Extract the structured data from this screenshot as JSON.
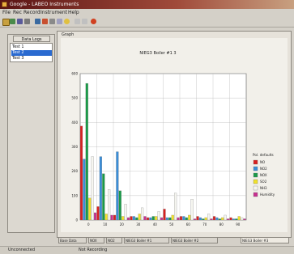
{
  "window": {
    "title": "Google - LABEO Instruments"
  },
  "menu": [
    "File",
    "Rec",
    "Record",
    "Instrument",
    "Help"
  ],
  "left_panel": {
    "button_label": "Data Logs",
    "items": [
      {
        "label": "Test 1",
        "selected": false
      },
      {
        "label": "Test 2",
        "selected": true
      },
      {
        "label": "Test 3",
        "selected": false
      }
    ]
  },
  "graph_panel": {
    "label": "Graph"
  },
  "colors": {
    "red": "#d82020",
    "blue": "#3a8ed8",
    "green": "#1a9a48",
    "yellow": "#f0e22a",
    "white": "#f6f6f0",
    "magenta": "#c83090"
  },
  "chart_data": {
    "type": "bar",
    "title": "NIEG3 Boiler #1 3",
    "categories": [
      "0",
      "10",
      "20",
      "30",
      "40",
      "50",
      "60",
      "70",
      "80",
      "90"
    ],
    "ylim": [
      0,
      600
    ],
    "yticks": [
      "600",
      "500",
      "400",
      "300",
      "200",
      "100",
      "0"
    ],
    "legend_title": "Pol. defaults",
    "series": [
      {
        "name": "NO",
        "color": "#d82020",
        "values": [
          385,
          55,
          20,
          15,
          10,
          45,
          15,
          15,
          15,
          10
        ]
      },
      {
        "name": "NO2",
        "color": "#3a8ed8",
        "values": [
          250,
          260,
          280,
          15,
          10,
          10,
          15,
          10,
          10,
          5
        ]
      },
      {
        "name": "NOX",
        "color": "#1a9a48",
        "values": [
          560,
          190,
          120,
          10,
          15,
          10,
          10,
          5,
          5,
          5
        ]
      },
      {
        "name": "SO2",
        "color": "#f0e22a",
        "values": [
          90,
          25,
          15,
          25,
          15,
          20,
          20,
          10,
          10,
          15
        ]
      },
      {
        "name": "NH3",
        "color": "#f6f6f0",
        "values": [
          260,
          125,
          65,
          50,
          35,
          110,
          85,
          25,
          20,
          10
        ]
      },
      {
        "name": "Humidity",
        "color": "#c83090",
        "values": [
          30,
          20,
          10,
          15,
          10,
          10,
          5,
          5,
          5,
          5
        ]
      }
    ],
    "grid": true,
    "legend_position": "right"
  },
  "tabs": [
    {
      "label": "Base Data",
      "active": false
    },
    {
      "label": "NOX",
      "active": false
    },
    {
      "label": "NO2",
      "active": false
    },
    {
      "label": "NIEG3 Boiler #1",
      "active": false
    },
    {
      "label": "NIEG3 Boiler #2",
      "active": false
    },
    {
      "label": "NIEG3 Boiler #3",
      "active": true
    }
  ],
  "status": [
    "Unconnected",
    "Not Recording"
  ]
}
